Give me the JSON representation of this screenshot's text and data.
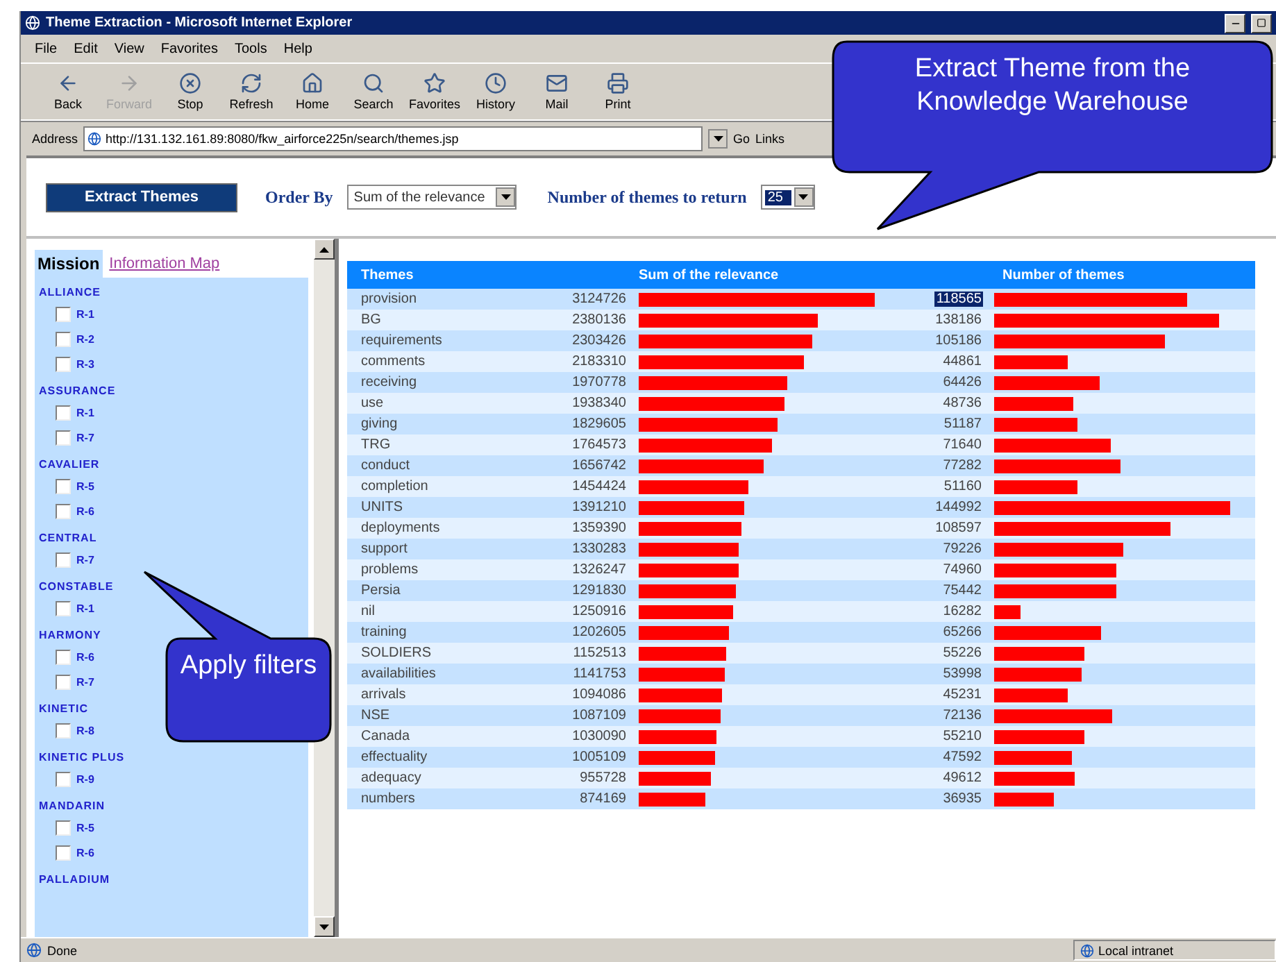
{
  "window": {
    "title": "Theme Extraction - Microsoft Internet Explorer"
  },
  "menu": [
    "File",
    "Edit",
    "View",
    "Favorites",
    "Tools",
    "Help"
  ],
  "toolbar": [
    {
      "kind": "back",
      "label": "Back",
      "disabled": false
    },
    {
      "kind": "forward",
      "label": "Forward",
      "disabled": true
    },
    {
      "kind": "stop",
      "label": "Stop",
      "disabled": false
    },
    {
      "kind": "refresh",
      "label": "Refresh",
      "disabled": false
    },
    {
      "kind": "home",
      "label": "Home",
      "disabled": false
    },
    {
      "kind": "search",
      "label": "Search",
      "disabled": false
    },
    {
      "kind": "favorites",
      "label": "Favorites",
      "disabled": false
    },
    {
      "kind": "history",
      "label": "History",
      "disabled": false
    },
    {
      "kind": "mail",
      "label": "Mail",
      "disabled": false
    },
    {
      "kind": "print",
      "label": "Print",
      "disabled": false
    }
  ],
  "address": {
    "label": "Address",
    "url": "http://131.132.161.89:8080/fkw_airforce225n/search/themes.jsp",
    "go": "Go",
    "links": "Links"
  },
  "controls": {
    "button": "Extract Themes",
    "order_label": "Order By",
    "order_value": "Sum of the relevance",
    "count_label": "Number of themes to return",
    "count_value": "25"
  },
  "sidebar": {
    "tabs": [
      {
        "label": "Mission",
        "selected": true
      },
      {
        "label": "Information Map",
        "selected": false
      }
    ],
    "groups": [
      {
        "name": "ALLIANCE",
        "items": [
          {
            "label": "R-1",
            "checked": false
          },
          {
            "label": "R-2",
            "checked": false
          },
          {
            "label": "R-3",
            "checked": false
          }
        ]
      },
      {
        "name": "ASSURANCE",
        "items": [
          {
            "label": "R-1",
            "checked": false
          },
          {
            "label": "R-7",
            "checked": false
          }
        ]
      },
      {
        "name": "CAVALIER",
        "items": [
          {
            "label": "R-5",
            "checked": false
          },
          {
            "label": "R-6",
            "checked": false
          }
        ]
      },
      {
        "name": "CENTRAL",
        "items": [
          {
            "label": "R-7",
            "checked": false
          }
        ]
      },
      {
        "name": "CONSTABLE",
        "items": [
          {
            "label": "R-1",
            "checked": false
          }
        ]
      },
      {
        "name": "HARMONY",
        "items": [
          {
            "label": "R-6",
            "checked": false
          },
          {
            "label": "R-7",
            "checked": false
          }
        ]
      },
      {
        "name": "KINETIC",
        "items": [
          {
            "label": "R-8",
            "checked": false
          }
        ]
      },
      {
        "name": "KINETIC PLUS",
        "items": [
          {
            "label": "R-9",
            "checked": false
          }
        ]
      },
      {
        "name": "MANDARIN",
        "items": [
          {
            "label": "R-5",
            "checked": false
          },
          {
            "label": "R-6",
            "checked": false
          }
        ]
      },
      {
        "name": "PALLADIUM"
      }
    ]
  },
  "table": {
    "columns": [
      "Themes",
      "Sum of the relevance",
      "Number of themes"
    ],
    "rows": [
      {
        "theme": "provision",
        "relevance": "3124726",
        "count": {
          "value": "118565",
          "selected": true
        }
      },
      {
        "theme": "BG",
        "relevance": "2380136",
        "count": {
          "value": "138186",
          "selected": false
        }
      },
      {
        "theme": "requirements",
        "relevance": "2303426",
        "count": {
          "value": "105186",
          "selected": false
        }
      },
      {
        "theme": "comments",
        "relevance": "2183310",
        "count": {
          "value": "44861",
          "selected": false
        }
      },
      {
        "theme": "receiving",
        "relevance": "1970778",
        "count": {
          "value": "64426",
          "selected": false
        }
      },
      {
        "theme": "use",
        "relevance": "1938340",
        "count": {
          "value": "48736",
          "selected": false
        }
      },
      {
        "theme": "giving",
        "relevance": "1829605",
        "count": {
          "value": "51187",
          "selected": false
        }
      },
      {
        "theme": "TRG",
        "relevance": "1764573",
        "count": {
          "value": "71640",
          "selected": false
        }
      },
      {
        "theme": "conduct",
        "relevance": "1656742",
        "count": {
          "value": "77282",
          "selected": false
        }
      },
      {
        "theme": "completion",
        "relevance": "1454424",
        "count": {
          "value": "51160",
          "selected": false
        }
      },
      {
        "theme": "UNITS",
        "relevance": "1391210",
        "count": {
          "value": "144992",
          "selected": false
        }
      },
      {
        "theme": "deployments",
        "relevance": "1359390",
        "count": {
          "value": "108597",
          "selected": false
        }
      },
      {
        "theme": "support",
        "relevance": "1330283",
        "count": {
          "value": "79226",
          "selected": false
        }
      },
      {
        "theme": "problems",
        "relevance": "1326247",
        "count": {
          "value": "74960",
          "selected": false
        }
      },
      {
        "theme": "Persia",
        "relevance": "1291830",
        "count": {
          "value": "75442",
          "selected": false
        }
      },
      {
        "theme": "nil",
        "relevance": "1250916",
        "count": {
          "value": "16282",
          "selected": false
        }
      },
      {
        "theme": "training",
        "relevance": "1202605",
        "count": {
          "value": "65266",
          "selected": false
        }
      },
      {
        "theme": "SOLDIERS",
        "relevance": "1152513",
        "count": {
          "value": "55226",
          "selected": false
        }
      },
      {
        "theme": "availabilities",
        "relevance": "1141753",
        "count": {
          "value": "53998",
          "selected": false
        }
      },
      {
        "theme": "arrivals",
        "relevance": "1094086",
        "count": {
          "value": "45231",
          "selected": false
        }
      },
      {
        "theme": "NSE",
        "relevance": "1087109",
        "count": {
          "value": "72136",
          "selected": false
        }
      },
      {
        "theme": "Canada",
        "relevance": "1030090",
        "count": {
          "value": "55210",
          "selected": false
        }
      },
      {
        "theme": "effectuality",
        "relevance": "1005109",
        "count": {
          "value": "47592",
          "selected": false
        }
      },
      {
        "theme": "adequacy",
        "relevance": "955728",
        "count": {
          "value": "49612",
          "selected": false
        }
      },
      {
        "theme": "numbers",
        "relevance": "874169",
        "count": {
          "value": "36935",
          "selected": false
        }
      }
    ]
  },
  "status_bar": {
    "text": "Done",
    "zone": "Local intranet"
  },
  "callouts": [
    {
      "text": "Extract Theme from the Knowledge Warehouse"
    },
    {
      "text": "Apply filters"
    }
  ]
}
